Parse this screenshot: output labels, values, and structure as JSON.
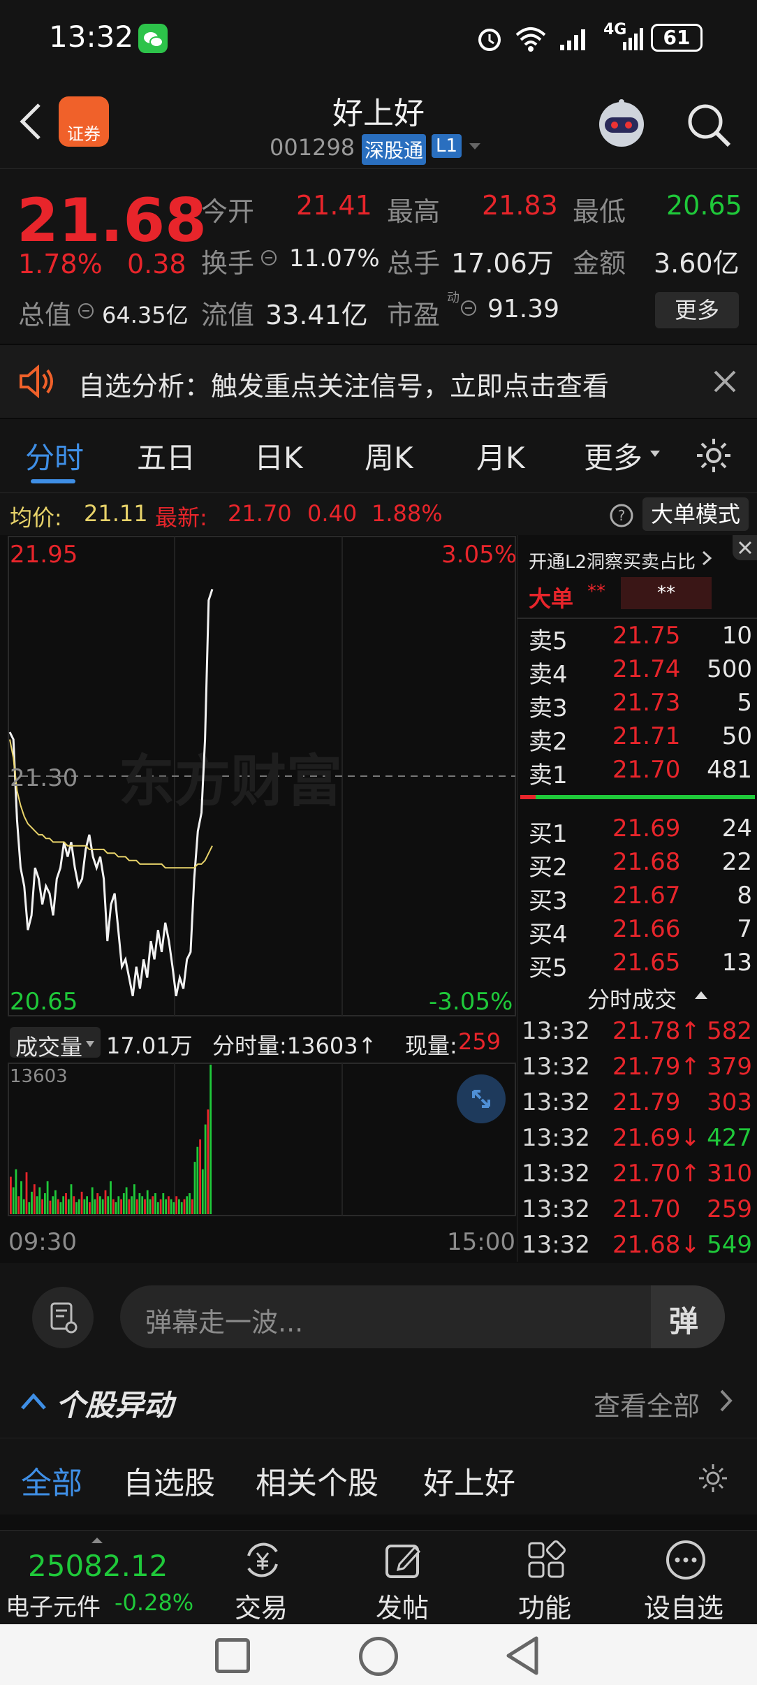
{
  "status": {
    "time": "13:32",
    "battery": "61",
    "network": "4G"
  },
  "header": {
    "title": "好上好",
    "code": "001298",
    "tag": "深股通",
    "level": "L1",
    "app_badge": "证券"
  },
  "quote": {
    "price": "21.68",
    "change_pct": "1.78%",
    "change": "0.38",
    "open_label": "今开",
    "open": "21.41",
    "high_label": "最高",
    "high": "21.83",
    "low_label": "最低",
    "low": "20.65",
    "turnover_label": "换手",
    "turnover": "11.07%",
    "volume_label": "总手",
    "volume": "17.06万",
    "amount_label": "金额",
    "amount": "3.60亿",
    "mktcap_label": "总值",
    "mktcap": "64.35亿",
    "float_label": "流值",
    "float": "33.41亿",
    "pe_label": "市盈",
    "pe_sup": "动",
    "pe": "91.39",
    "more": "更多"
  },
  "banner": {
    "text": "自选分析：触发重点关注信号，立即点击查看"
  },
  "tabs": [
    "分时",
    "五日",
    "日K",
    "周K",
    "月K",
    "更多"
  ],
  "infoline": {
    "avg_label": "均价:",
    "avg": "21.11",
    "last_label": "最新:",
    "last": "21.70",
    "chg": "0.40",
    "pct": "1.88%",
    "mode": "大单模式"
  },
  "chart": {
    "y_high": "21.95",
    "y_mid": "21.30",
    "y_low": "20.65",
    "pct_high": "3.05%",
    "pct_low": "-3.05%",
    "watermark": "东方财富",
    "vol_label": "成交量",
    "vol_total": "17.01万",
    "vol_minute": "分时量:13603↑",
    "now_label": "现量:",
    "now_val": "259",
    "vol_max": "13603",
    "t_start": "09:30",
    "t_end": "15:00"
  },
  "chart_data": {
    "type": "line",
    "title": "",
    "ylim": [
      20.65,
      21.95
    ],
    "series": [
      {
        "name": "",
        "values": [
          21.42,
          21.4,
          21.18,
          21.05,
          21.0,
          20.88,
          20.92,
          21.05,
          21.02,
          20.95,
          21.0,
          20.98,
          20.92,
          21.02,
          21.05,
          21.12,
          21.08,
          21.12,
          21.05,
          21.0,
          21.02,
          21.1,
          21.14,
          21.08,
          21.05,
          21.08,
          21.02,
          20.85,
          20.95,
          20.98,
          20.88,
          20.78,
          20.8,
          20.75,
          20.7,
          20.78,
          20.72,
          20.8,
          20.75,
          20.85,
          20.8,
          20.88,
          20.82,
          20.9,
          20.85,
          20.78,
          20.7,
          20.75,
          20.72,
          20.8,
          20.82,
          21.02,
          21.15,
          21.2,
          21.4,
          21.78,
          21.81
        ]
      },
      {
        "name": "",
        "values": [
          21.4,
          21.35,
          21.26,
          21.22,
          21.19,
          21.17,
          21.16,
          21.15,
          21.14,
          21.14,
          21.13,
          21.13,
          21.12,
          21.12,
          21.12,
          21.12,
          21.11,
          21.11,
          21.11,
          21.11,
          21.11,
          21.11,
          21.1,
          21.1,
          21.1,
          21.1,
          21.1,
          21.09,
          21.09,
          21.09,
          21.08,
          21.08,
          21.08,
          21.07,
          21.07,
          21.07,
          21.06,
          21.06,
          21.06,
          21.06,
          21.06,
          21.06,
          21.06,
          21.05,
          21.05,
          21.05,
          21.05,
          21.05,
          21.05,
          21.05,
          21.05,
          21.05,
          21.06,
          21.06,
          21.07,
          21.09,
          21.11
        ]
      }
    ],
    "volume_max": 13603
  },
  "orderbook": {
    "promo": "开通L2洞察买卖占比",
    "big_label": "大单",
    "big_val": "**",
    "big_val2": "**",
    "asks": [
      [
        "卖5",
        "21.75",
        "10"
      ],
      [
        "卖4",
        "21.74",
        "500"
      ],
      [
        "卖3",
        "21.73",
        "5"
      ],
      [
        "卖2",
        "21.71",
        "50"
      ],
      [
        "卖1",
        "21.70",
        "481"
      ]
    ],
    "bids": [
      [
        "买1",
        "21.69",
        "24"
      ],
      [
        "买2",
        "21.68",
        "22"
      ],
      [
        "买3",
        "21.67",
        "8"
      ],
      [
        "买4",
        "21.66",
        "7"
      ],
      [
        "买5",
        "21.65",
        "13"
      ]
    ],
    "trades_title": "分时成交",
    "trades": [
      [
        "13:32",
        "21.78↑",
        "582",
        "red"
      ],
      [
        "13:32",
        "21.79↑",
        "379",
        "red"
      ],
      [
        "13:32",
        "21.79",
        "303",
        "red"
      ],
      [
        "13:32",
        "21.69↓",
        "427",
        "green"
      ],
      [
        "13:32",
        "21.70↑",
        "310",
        "red"
      ],
      [
        "13:32",
        "21.70",
        "259",
        "red"
      ],
      [
        "13:32",
        "21.68↓",
        "549",
        "green"
      ]
    ]
  },
  "danmu": {
    "placeholder": "弹幕走一波...",
    "btn": "弹"
  },
  "movement": {
    "title": "个股异动",
    "view_all": "查看全部"
  },
  "filters": [
    "全部",
    "自选股",
    "相关个股",
    "好上好"
  ],
  "bottomnav": {
    "index_val": "25082.12",
    "index_name": "电子元件",
    "index_pct": "-0.28%",
    "items": [
      "交易",
      "发帖",
      "功能",
      "设自选"
    ]
  },
  "colors": {
    "red": "#e8252b",
    "green": "#1fc93a",
    "blue": "#3f8fe6",
    "orange": "#f0612a",
    "avg_line": "#e8d36a"
  }
}
